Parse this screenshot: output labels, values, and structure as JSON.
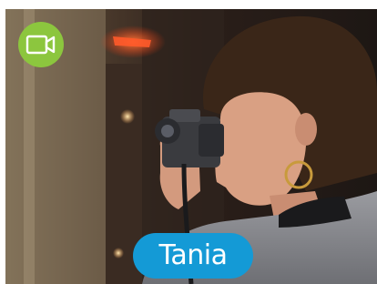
{
  "video_tile": {
    "person_name": "Tania",
    "badge_icon": "video-camera-icon",
    "badge_color": "#8cc63e",
    "name_pill_color": "#149ad6",
    "photo_subject": "woman-photographing-with-camera"
  }
}
